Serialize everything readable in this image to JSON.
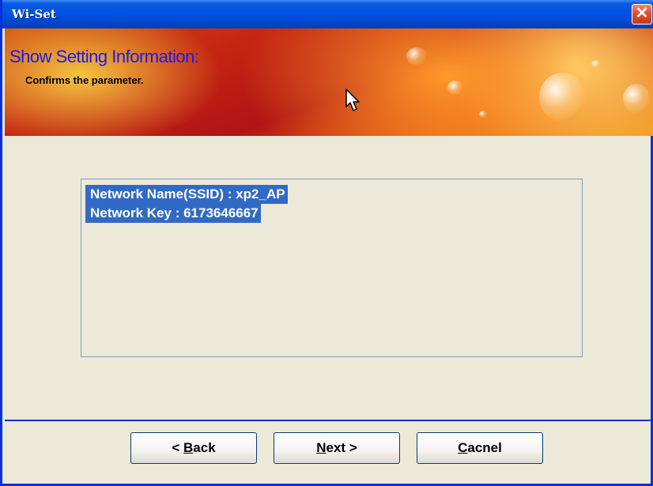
{
  "window": {
    "title": "Wi-Set",
    "close_symbol": "✕"
  },
  "header": {
    "title": "Show Setting Information:",
    "subtitle": "Confirms the parameter."
  },
  "settings_list": [
    "Network Name(SSID) : xp2_AP",
    "Network Key : 6173646667"
  ],
  "buttons": {
    "back": {
      "prefix": "< ",
      "mnemonic": "B",
      "rest": "ack"
    },
    "next": {
      "mnemonic": "N",
      "rest": "ext",
      "suffix": " >"
    },
    "cancel": {
      "mnemonic": "C",
      "rest": "acnel"
    }
  },
  "colors": {
    "title_bar": "#0054e3",
    "header_title": "#1a1ae8",
    "selection": "#316ac5",
    "dialog_bg": "#ece9d8"
  }
}
